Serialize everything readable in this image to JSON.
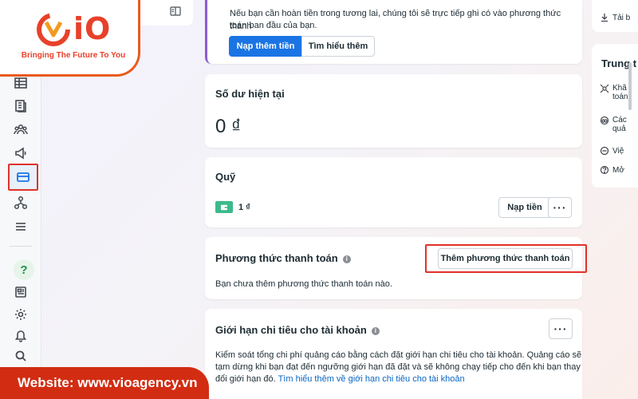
{
  "logo": {
    "brand_text": "iO",
    "tagline": "Bringing The Future To You"
  },
  "top_notice": {
    "text_line1": "Nếu bạn cần hoàn tiền trong tương lai, chúng tôi sẽ trực tiếp ghi có vào phương thức thanh",
    "text_line2": "toán ban đầu của bạn.",
    "primary_button": "Nạp thêm tiền",
    "secondary_button": "Tìm hiểu thêm"
  },
  "balance": {
    "title": "Số dư hiện tại",
    "amount": "0 ₫"
  },
  "funds": {
    "title": "Quỹ",
    "amount": "1 ₫",
    "add_button": "Nạp tiền",
    "more_button": "···"
  },
  "payment_methods": {
    "title": "Phương thức thanh toán",
    "add_button": "Thêm phương thức thanh toán",
    "empty_text": "Bạn chưa thêm phương thức thanh toán nào."
  },
  "spending_limit": {
    "title": "Giới hạn chi tiêu cho tài khoản",
    "more_button": "···",
    "description_line1": "Kiểm soát tổng chi phí quảng cáo bằng cách đặt giới hạn chi tiêu cho tài khoản. Quảng cáo sẽ",
    "description_line2": "tạm dừng khi bạn đạt đến ngưỡng giới hạn đã đặt và sẽ không chạy tiếp cho đến khi bạn thay",
    "description_line3_prefix": "đổi giới hạn đó.",
    "description_link": "Tìm hiểu thêm về giới hạn chi tiêu cho tài khoản"
  },
  "right_panel": {
    "download_label": "Tải b",
    "section_title": "Trung t",
    "items": [
      {
        "label": "Khã",
        "sub": "toán"
      },
      {
        "label": "Các",
        "sub": "quả"
      },
      {
        "label": "Việ",
        "sub": ""
      },
      {
        "label": "Mở",
        "sub": ""
      }
    ]
  },
  "banner": {
    "text": "Website: www.vioagency.vn"
  },
  "colors": {
    "accent": "#1b74e4",
    "highlight": "#e0312c",
    "brand": "#e8412a",
    "banner": "#d22d12"
  }
}
